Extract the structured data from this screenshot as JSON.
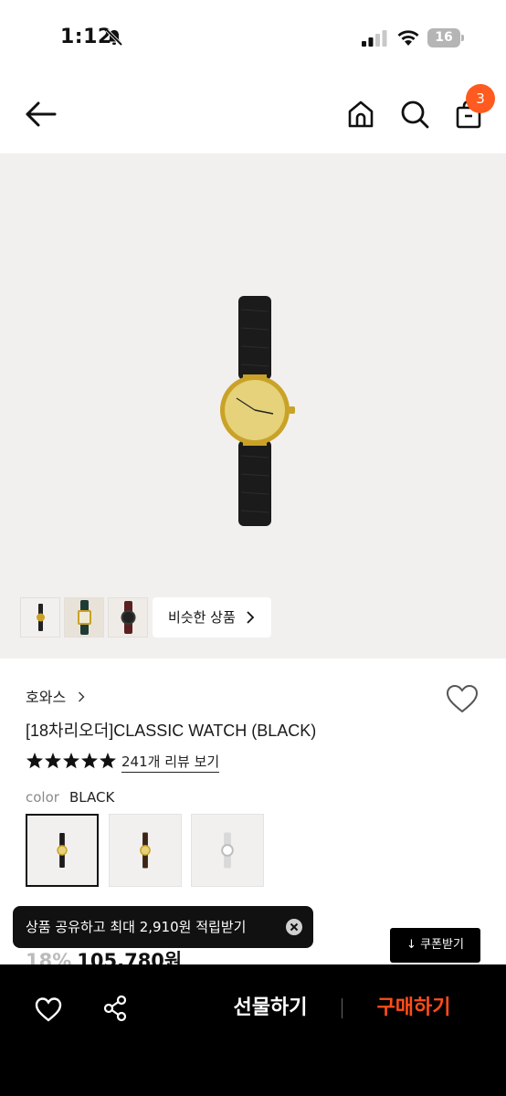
{
  "status_bar": {
    "time": "1:12",
    "battery_level": "16",
    "icons": [
      "bell-muted-icon",
      "signal-icon",
      "wifi-icon",
      "battery-icon"
    ]
  },
  "header": {
    "icons": [
      "back-arrow-icon",
      "home-icon",
      "search-icon",
      "shopping-bag-icon"
    ],
    "cart_count": "3",
    "badge_color": "#ff5a1f"
  },
  "gallery": {
    "thumbnails": [
      "thumbnail-1",
      "thumbnail-2",
      "thumbnail-3"
    ],
    "similar_label": "비슷한 상품"
  },
  "product": {
    "brand": "호와스",
    "title": "[18차리오더]CLASSIC WATCH (BLACK)",
    "rating_stars": 5,
    "review_link": "241개 리뷰 보기",
    "color_label": "color",
    "color_value": "BLACK",
    "discount": "18%",
    "price": "105,780원"
  },
  "toast": {
    "message": "상품 공유하고 최대 2,910원 적립받기"
  },
  "coupon": {
    "label": "쿠폰받기"
  },
  "bottom_bar": {
    "gift_label": "선물하기",
    "buy_label": "구매하기",
    "buy_color": "#ff4d1a"
  }
}
